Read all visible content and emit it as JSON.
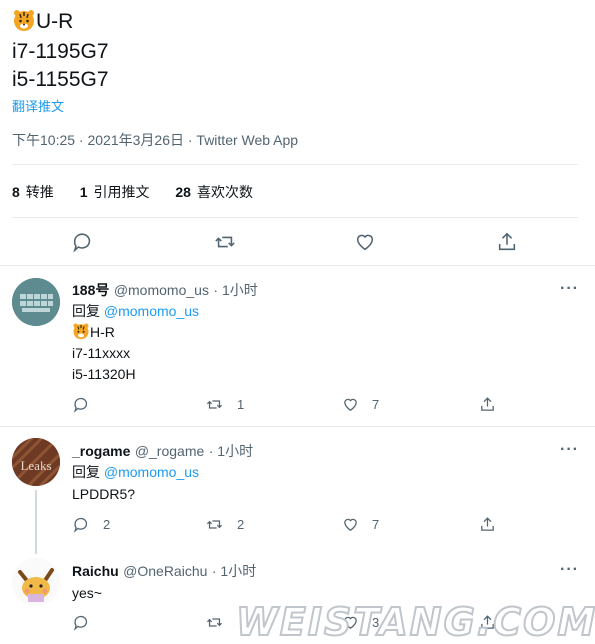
{
  "tweet": {
    "line1": "U-R",
    "line2": "i7-1195G7",
    "line3": "i5-1155G7",
    "translate": "翻译推文",
    "meta": "下午10:25 · 2021年3月26日 · Twitter Web App",
    "stats": {
      "retweets_count": "8",
      "retweets_label": "转推",
      "quotes_count": "1",
      "quotes_label": "引用推文",
      "likes_count": "28",
      "likes_label": "喜欢次数"
    }
  },
  "replies": [
    {
      "name": "188号",
      "handle": "@momomo_us",
      "time": "· 1小时",
      "reply_prefix": "回复",
      "reply_to": "@momomo_us",
      "lines": [
        "H-R",
        "i7-11xxxx",
        "i5-11320H"
      ],
      "retweets": "1",
      "likes": "7"
    },
    {
      "name": "_rogame",
      "handle": "@_rogame",
      "time": "· 1小时",
      "reply_prefix": "回复",
      "reply_to": "@momomo_us",
      "avatar_text": "Leaks",
      "lines": [
        "LPDDR5?"
      ],
      "replies": "2",
      "retweets": "2",
      "likes": "7"
    },
    {
      "name": "Raichu",
      "handle": "@OneRaichu",
      "time": "· 1小时",
      "lines": [
        "yes~"
      ],
      "likes": "3"
    }
  ],
  "watermark": "WEISTANG.COM"
}
